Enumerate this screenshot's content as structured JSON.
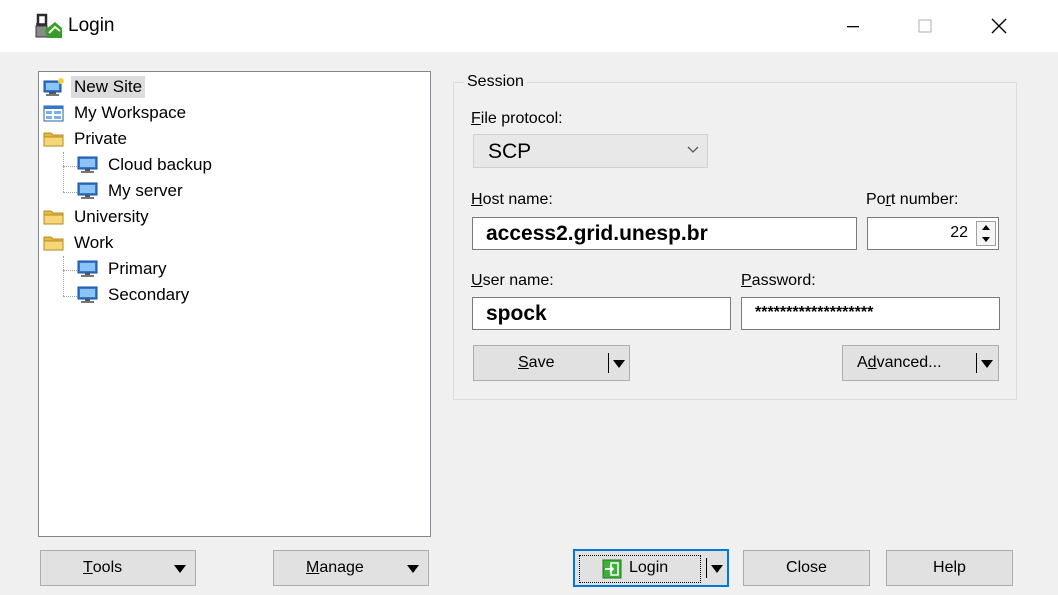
{
  "window": {
    "title": "Login"
  },
  "tree": {
    "items": [
      {
        "label": "New Site",
        "icon": "new-site-icon"
      },
      {
        "label": "My Workspace",
        "icon": "workspace-icon"
      },
      {
        "label": "Private",
        "icon": "folder-icon"
      },
      {
        "label": "Cloud backup",
        "icon": "computer-icon"
      },
      {
        "label": "My server",
        "icon": "computer-icon"
      },
      {
        "label": "University",
        "icon": "folder-icon"
      },
      {
        "label": "Work",
        "icon": "folder-icon"
      },
      {
        "label": "Primary",
        "icon": "computer-icon"
      },
      {
        "label": "Secondary",
        "icon": "computer-icon"
      }
    ],
    "selected": "New Site"
  },
  "session": {
    "legend": "Session",
    "protocol_label": "File protocol:",
    "protocol_value": "SCP",
    "host_label": "Host name:",
    "host_value": "access2.grid.unesp.br",
    "port_label": "Port number:",
    "port_value": "22",
    "user_label": "User name:",
    "user_value": "spock",
    "password_label": "Password:",
    "password_value": "*******************",
    "save_label": "Save",
    "advanced_label": "Advanced..."
  },
  "footer": {
    "tools_label": "Tools",
    "manage_label": "Manage",
    "login_label": "Login",
    "close_label": "Close",
    "help_label": "Help"
  },
  "colors": {
    "accent": "#0078d7",
    "window_bg": "#f0f0f0"
  }
}
